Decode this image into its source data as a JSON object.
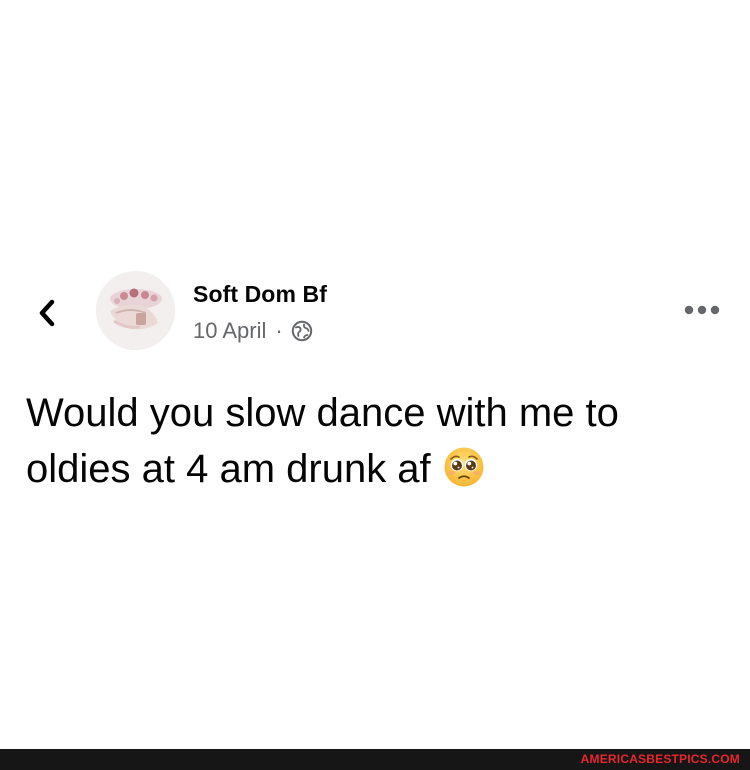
{
  "post": {
    "author_name": "Soft Dom Bf",
    "date": "10 April",
    "separator": "·",
    "text": "Would you slow dance with me to oldies at 4 am drunk af"
  },
  "icons": {
    "back": "chevron-left-icon",
    "privacy": "globe-icon",
    "more": "more-options-icon",
    "emoji": "pleading-face-emoji"
  },
  "footer": {
    "watermark": "AMERICASBESTPICS.COM"
  },
  "colors": {
    "text_primary": "#050505",
    "text_secondary": "#65676b",
    "footer_bg": "#161616",
    "watermark": "#e8262d"
  }
}
